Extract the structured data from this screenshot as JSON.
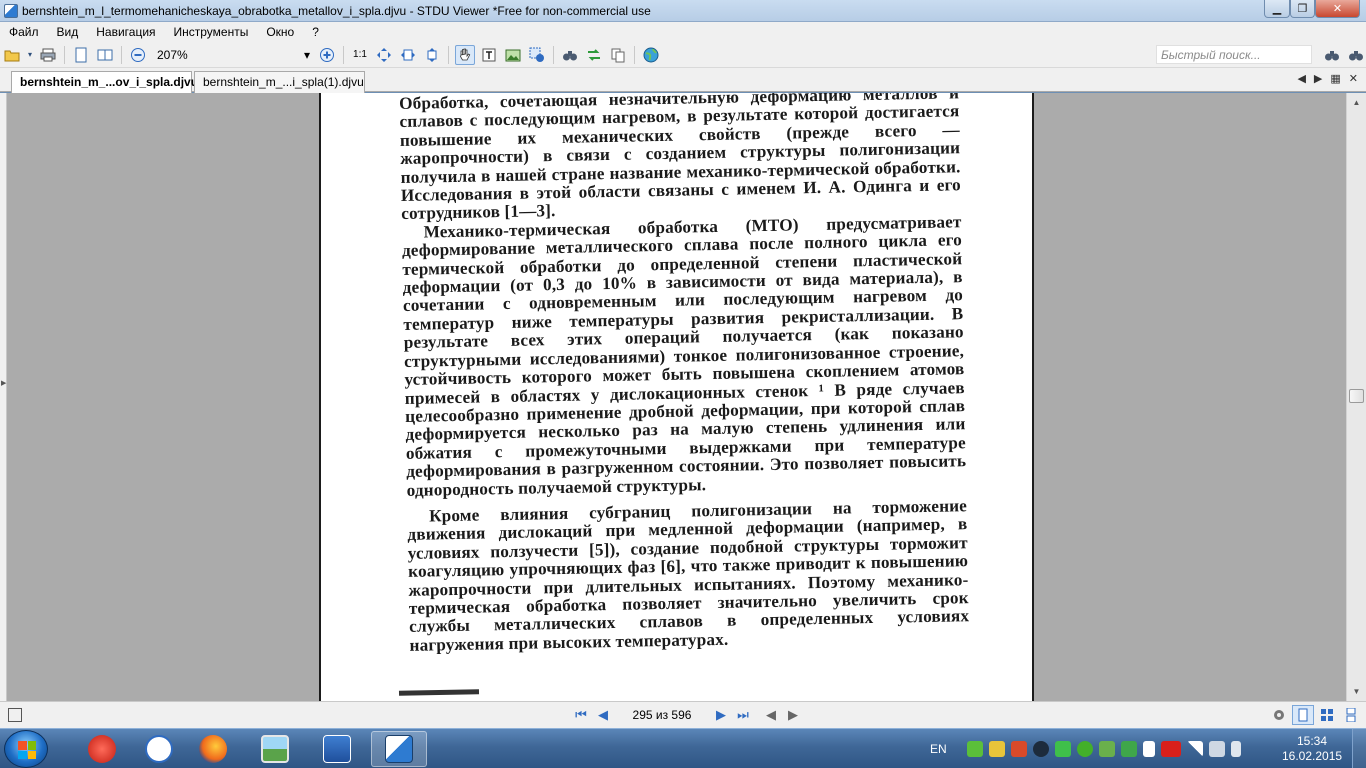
{
  "window": {
    "title": "bernshtein_m_l_termomehanicheskaya_obrabotka_metallov_i_spla.djvu - STDU Viewer *Free for non-commercial use",
    "min_icon": "minimize-icon",
    "max_icon": "maximize-icon",
    "close_icon": "close-icon",
    "min_glyph": "▁",
    "max_glyph": "❐",
    "close_glyph": "✕"
  },
  "menu": [
    {
      "label": "Файл"
    },
    {
      "label": "Вид"
    },
    {
      "label": "Навигация"
    },
    {
      "label": "Инструменты"
    },
    {
      "label": "Окно"
    },
    {
      "label": "?"
    }
  ],
  "toolbar": {
    "zoom_value": "207%",
    "zoom_arrow": "▾",
    "actual_size_label": "1:1",
    "search_placeholder": "Быстрый поиск..."
  },
  "tabs": [
    {
      "label": "bernshtein_m_...ov_i_spla.djvu",
      "active": true
    },
    {
      "label": "bernshtein_m_...i_spla(1).djvu",
      "active": false
    }
  ],
  "tabnav": {
    "prev": "◀",
    "next": "▶",
    "list": "▦",
    "close": "✕"
  },
  "page_content": {
    "paragraphs": [
      "Обработка, сочетающая незначительную деформацию металлов и сплавов с последующим нагревом, в результате которой достигается повышение их механических свойств (прежде всего — жаропрочности) в связи с созданием структуры полигонизации получила в нашей стране название механико-термической обработки. Исследования в этой области связаны с именем И. А. Одинга и его сотрудников [1—3].",
      "Механико-термическая обработка (МТО) предусматривает деформирование металлического сплава после полного цикла его термической обработки до определенной степени пластической деформации (от 0,3 до 10% в зависимости от вида материала), в сочетании с одновременным или последующим нагревом до температур ниже температуры развития рекристаллизации. В результате всех этих операций получается (как показано структурными исследованиями) тонкое полигонизованное строение, устойчивость которого может быть повышена скоплением атомов примесей в областях у дислокационных стенок ¹ В ряде случаев целесообразно применение дробной деформации, при которой сплав деформируется несколько раз на малую степень удлинения или обжатия с промежуточными выдержками при температуре деформирования в разгруженном состоянии. Это позволяет повысить однородность получаемой структуры.",
      "Кроме влияния субграниц полигонизации на торможение движения дислокаций при медленной деформации (например, в условиях ползучести [5]), создание подобной структуры торможит коагуляцию упрочняющих фаз [6], что также приводит к повышению жаропрочности при длительных испытаниях. Поэтому механико-термическая обработка позволяет значительно увеличить срок службы металлических сплавов в определенных условиях нагружения при высоких температурах."
    ]
  },
  "statusbar": {
    "page_indicator": "295 из 596",
    "first": "⏮",
    "prev": "◀",
    "next": "▶",
    "last": "⏭",
    "back": "◀",
    "forward": "▶"
  },
  "taskbar": {
    "lang": "EN",
    "time": "15:34",
    "date": "16.02.2015"
  },
  "colors": {
    "taskbar": "#3f6797",
    "doc_background": "#ababab",
    "accent": "#2f6bc1"
  }
}
